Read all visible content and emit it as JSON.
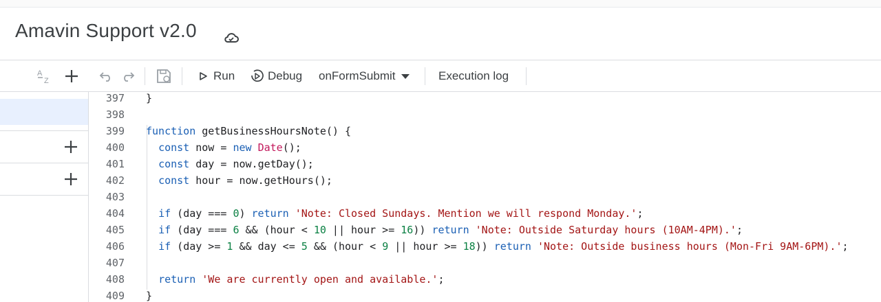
{
  "app": {
    "title": "Amavin Support v2.0",
    "cloud_icon": "cloud-saved-icon"
  },
  "toolbar": {
    "run_label": "Run",
    "debug_label": "Debug",
    "function_select": "onFormSubmit",
    "execution_log_label": "Execution log"
  },
  "editor": {
    "lines": [
      {
        "n": "397",
        "t": "}"
      },
      {
        "n": "398",
        "t": ""
      },
      {
        "n": "399",
        "t": "function getBusinessHoursNote() {"
      },
      {
        "n": "400",
        "t": "  const now = new Date();"
      },
      {
        "n": "401",
        "t": "  const day = now.getDay();"
      },
      {
        "n": "402",
        "t": "  const hour = now.getHours();"
      },
      {
        "n": "403",
        "t": ""
      },
      {
        "n": "404",
        "t": "  if (day === 0) return 'Note: Closed Sundays. Mention we will respond Monday.';"
      },
      {
        "n": "405",
        "t": "  if (day === 6 && (hour < 10 || hour >= 16)) return 'Note: Outside Saturday hours (10AM-4PM).';"
      },
      {
        "n": "406",
        "t": "  if (day >= 1 && day <= 5 && (hour < 9 || hour >= 18)) return 'Note: Outside business hours (Mon-Fri 9AM-6PM).';"
      },
      {
        "n": "407",
        "t": ""
      },
      {
        "n": "408",
        "t": "  return 'We are currently open and available.';"
      },
      {
        "n": "409",
        "t": "}"
      }
    ]
  },
  "colors": {
    "keyword": "#1a5fb4",
    "string": "#a31515",
    "number": "#0b8043",
    "class": "#c2185b"
  }
}
